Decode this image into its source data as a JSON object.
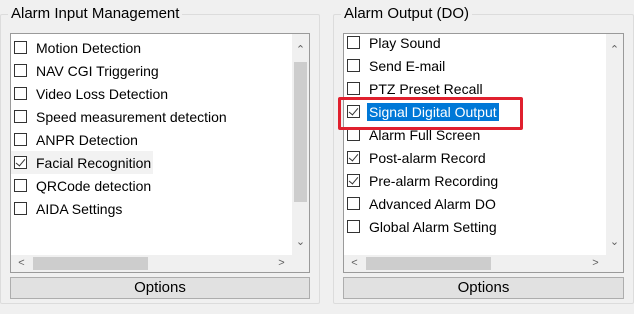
{
  "input_group": {
    "title": "Alarm Input Management",
    "items": [
      {
        "label": "Motion Detection",
        "checked": false
      },
      {
        "label": "NAV CGI Triggering",
        "checked": false
      },
      {
        "label": "Video Loss Detection",
        "checked": false
      },
      {
        "label": "Speed measurement detection",
        "checked": false
      },
      {
        "label": "ANPR Detection",
        "checked": false
      },
      {
        "label": "Facial Recognition",
        "checked": true
      },
      {
        "label": "QRCode detection",
        "checked": false
      },
      {
        "label": "AIDA Settings",
        "checked": false
      }
    ],
    "options_label": "Options"
  },
  "output_group": {
    "title": "Alarm Output (DO)",
    "items": [
      {
        "label": "Play Sound",
        "checked": false
      },
      {
        "label": "Send E-mail",
        "checked": false
      },
      {
        "label": "PTZ Preset Recall",
        "checked": false
      },
      {
        "label": "Signal Digital Output",
        "checked": true,
        "selected": true
      },
      {
        "label": "Alarm Full Screen",
        "checked": false
      },
      {
        "label": "Post-alarm Record",
        "checked": true
      },
      {
        "label": "Pre-alarm Recording",
        "checked": true
      },
      {
        "label": "Advanced Alarm DO",
        "checked": false
      },
      {
        "label": "Global Alarm Setting",
        "checked": false
      }
    ],
    "options_label": "Options"
  },
  "icons": {
    "scroll_up": "chevron-up-icon",
    "scroll_down": "chevron-down-icon",
    "scroll_left": "chevron-left-icon",
    "scroll_right": "chevron-right-icon"
  },
  "colors": {
    "selection": "#0078d7",
    "highlight_annotation": "#e0202e"
  }
}
